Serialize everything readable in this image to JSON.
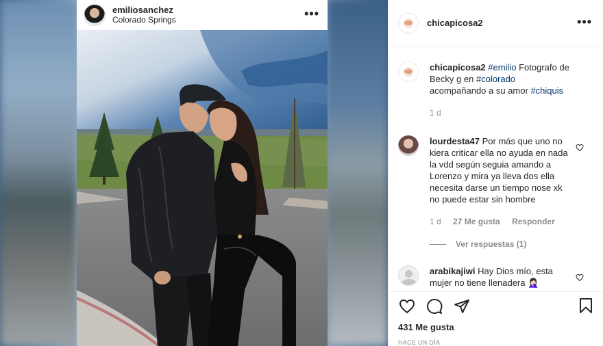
{
  "post": {
    "username": "emiliosanchez",
    "location": "Colorado Springs",
    "more_icon": "more-horizontal-icon"
  },
  "panel": {
    "username": "chicapicosa2",
    "more_icon": "more-horizontal-icon",
    "caption": {
      "username": "chicapicosa2",
      "tag1": "#emilio",
      "text1": " Fotografo de Becky g en ",
      "tag2": "#colorado",
      "text2": " acompañando a su amor ",
      "tag3": "#chiquis",
      "time": "1 d"
    },
    "comments": [
      {
        "username": "lourdesta47",
        "text": " Por más que uno no kiera criticar ella no ayuda en nada la vdd según seguia amando a Lorenzo y mira ya lleva dos ella necesita darse un tiempo nose xk no puede estar sin hombre",
        "time": "1 d",
        "likes": "27 Me gusta",
        "reply": "Responder",
        "view_replies": "Ver respuestas (1)"
      },
      {
        "username": "arabikajiwi",
        "text": " Hay Dios mío, esta mujer no tiene llenadera 🤦🏻‍♀️"
      }
    ],
    "likes": "431 Me gusta",
    "timestamp": "HACE UN DÍA"
  }
}
